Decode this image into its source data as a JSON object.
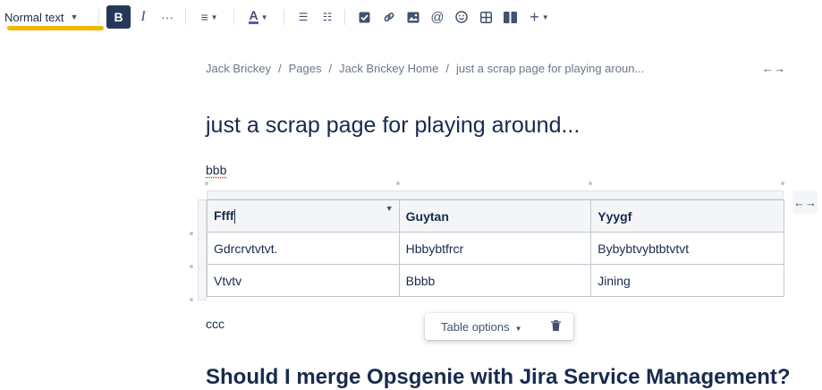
{
  "toolbar": {
    "text_style": "Normal text",
    "bold": "B",
    "italic": "I",
    "more": "···",
    "align_icon": "≡",
    "color_letter": "A",
    "bullet_icon": "☰",
    "numbered_icon": "☷",
    "insert_plus": "+",
    "accent": "#f2b705",
    "active_bg": "#253858"
  },
  "breadcrumb": [
    "Jack Brickey",
    "Pages",
    "Jack Brickey Home",
    "just a scrap page for playing aroun..."
  ],
  "breadcrumb_sep": "/",
  "page": {
    "title": "just a scrap page for playing around...",
    "para1": "bbb",
    "para2": "ccc",
    "next_heading": "Should I merge Opsgenie with Jira Service Management?"
  },
  "table": {
    "headers": [
      "Ffff",
      "Guytan",
      "Yyygf"
    ],
    "rows": [
      [
        "Gdrcrvtvtvt.",
        "Hbbybtfrcr",
        "Bybybtvybtbtvtvt"
      ],
      [
        "Vtvtv",
        "Bbbb",
        "Jining"
      ]
    ]
  },
  "table_options": {
    "label": "Table options"
  },
  "icons": [
    "chevron-down-icon",
    "more-icon",
    "align-icon",
    "text-color-icon",
    "bullet-list-icon",
    "numbered-list-icon",
    "checkbox-icon",
    "link-icon",
    "image-icon",
    "mention-icon",
    "emoji-icon",
    "table-icon",
    "layout-icon",
    "plus-icon",
    "expand-icon",
    "trash-icon"
  ]
}
